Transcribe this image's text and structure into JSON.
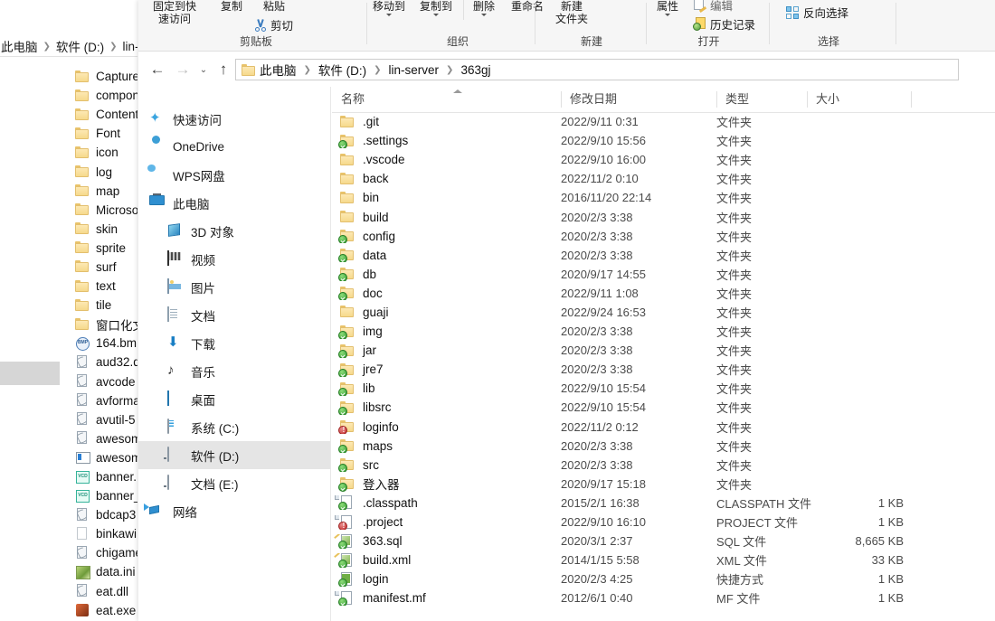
{
  "background_window": {
    "breadcrumb": [
      "此电脑",
      "软件 (D:)",
      "lin-"
    ],
    "files": [
      {
        "name": "Capture",
        "icon": "folder-icon"
      },
      {
        "name": "compon",
        "icon": "folder-icon"
      },
      {
        "name": "Content",
        "icon": "folder-icon"
      },
      {
        "name": "Font",
        "icon": "folder-icon"
      },
      {
        "name": "icon",
        "icon": "folder-icon"
      },
      {
        "name": "log",
        "icon": "folder-icon"
      },
      {
        "name": "map",
        "icon": "folder-icon"
      },
      {
        "name": "Microso",
        "icon": "folder-icon"
      },
      {
        "name": "skin",
        "icon": "folder-icon"
      },
      {
        "name": "sprite",
        "icon": "folder-icon"
      },
      {
        "name": "surf",
        "icon": "folder-icon"
      },
      {
        "name": "text",
        "icon": "folder-icon"
      },
      {
        "name": "tile",
        "icon": "folder-icon"
      },
      {
        "name": "窗口化文",
        "icon": "folder-icon"
      },
      {
        "name": "164.bm",
        "icon": "bmp-file-icon"
      },
      {
        "name": "aud32.d",
        "icon": "dll-file-icon"
      },
      {
        "name": "avcode",
        "icon": "dll-file-icon"
      },
      {
        "name": "avforma",
        "icon": "dll-file-icon"
      },
      {
        "name": "avutil-5",
        "icon": "dll-file-icon"
      },
      {
        "name": "awesom",
        "icon": "dll-file-icon"
      },
      {
        "name": "awesom",
        "icon": "app-file-icon"
      },
      {
        "name": "banner.",
        "icon": "vcd-file-icon"
      },
      {
        "name": "banner_",
        "icon": "vcd-file-icon"
      },
      {
        "name": "bdcap3",
        "icon": "dll-file-icon"
      },
      {
        "name": "binkawi",
        "icon": "blank-file-icon"
      },
      {
        "name": "chigame",
        "icon": "dll-file-icon"
      },
      {
        "name": "data.ini",
        "icon": "ini-file-icon"
      },
      {
        "name": "eat.dll",
        "icon": "dll-file-icon"
      },
      {
        "name": "eat.exe",
        "icon": "exe-file-icon"
      }
    ]
  },
  "ribbon": {
    "groups": [
      {
        "name": "剪贴板",
        "buttons": [
          {
            "label_line1": "固定到快",
            "label_line2": "速访问"
          },
          {
            "label_line1": "复制",
            "label_line2": ""
          },
          {
            "label_line1": "粘贴",
            "label_line2": ""
          },
          {
            "label_line1": "剪切",
            "icon": "scissors-icon"
          }
        ]
      },
      {
        "name": "组织",
        "buttons": [
          {
            "label_line1": "移动到",
            "has_dropdown": true
          },
          {
            "label_line1": "复制到",
            "has_dropdown": true
          },
          {
            "label_line1": "删除",
            "has_dropdown": true
          },
          {
            "label_line1": "重命名",
            "has_dropdown": false
          }
        ]
      },
      {
        "name": "新建",
        "buttons": [
          {
            "label_line1": "新建",
            "label_line2": "文件夹"
          }
        ]
      },
      {
        "name": "打开",
        "buttons": [
          {
            "label_line1": "属性",
            "has_dropdown": true,
            "icon": "properties-icon"
          },
          {
            "label_line1": "编辑",
            "icon": "edit-icon"
          },
          {
            "label_line1": "历史记录",
            "icon": "history-icon"
          }
        ]
      },
      {
        "name": "选择",
        "buttons": [
          {
            "label_line1": "反向选择",
            "icon": "invert-selection-icon"
          }
        ]
      }
    ]
  },
  "navigation": {
    "back_icon": "back-arrow-icon",
    "forward_icon": "forward-arrow-icon",
    "recent_icon": "chevron-down-icon",
    "up_icon": "up-arrow-icon",
    "breadcrumb": [
      "此电脑",
      "软件 (D:)",
      "lin-server",
      "363gj"
    ]
  },
  "nav_pane": {
    "items": [
      {
        "label": "快速访问",
        "icon": "pin-icon",
        "level": 0,
        "selected": false
      },
      {
        "label": "OneDrive",
        "icon": "cloud-icon",
        "level": 0,
        "selected": false
      },
      {
        "label": "WPS网盘",
        "icon": "wps-cloud-icon",
        "level": 0,
        "selected": false
      },
      {
        "label": "此电脑",
        "icon": "this-pc-icon",
        "level": 0,
        "selected": false
      },
      {
        "label": "3D 对象",
        "icon": "3d-objects-icon",
        "level": 1,
        "selected": false
      },
      {
        "label": "视频",
        "icon": "videos-icon",
        "level": 1,
        "selected": false
      },
      {
        "label": "图片",
        "icon": "pictures-icon",
        "level": 1,
        "selected": false
      },
      {
        "label": "文档",
        "icon": "documents-icon",
        "level": 1,
        "selected": false
      },
      {
        "label": "下载",
        "icon": "downloads-icon",
        "level": 1,
        "selected": false
      },
      {
        "label": "音乐",
        "icon": "music-icon",
        "level": 1,
        "selected": false
      },
      {
        "label": "桌面",
        "icon": "desktop-icon",
        "level": 1,
        "selected": false
      },
      {
        "label": "系统 (C:)",
        "icon": "system-drive-icon",
        "level": 1,
        "selected": false
      },
      {
        "label": "软件 (D:)",
        "icon": "drive-icon",
        "level": 1,
        "selected": true
      },
      {
        "label": "文档 (E:)",
        "icon": "drive-icon",
        "level": 1,
        "selected": false
      },
      {
        "label": "网络",
        "icon": "network-icon",
        "level": 0,
        "selected": false
      }
    ]
  },
  "file_list": {
    "columns": [
      {
        "label": "名称",
        "sorted": true
      },
      {
        "label": "修改日期",
        "sorted": false
      },
      {
        "label": "类型",
        "sorted": false
      },
      {
        "label": "大小",
        "sorted": false
      }
    ],
    "rows": [
      {
        "name": ".git",
        "date": "2022/9/11 0:31",
        "type": "文件夹",
        "size": "",
        "icon": "folder-icon",
        "badge": "none"
      },
      {
        "name": ".settings",
        "date": "2022/9/10 15:56",
        "type": "文件夹",
        "size": "",
        "icon": "folder-icon",
        "badge": "synced"
      },
      {
        "name": ".vscode",
        "date": "2022/9/10 16:00",
        "type": "文件夹",
        "size": "",
        "icon": "folder-icon",
        "badge": "none"
      },
      {
        "name": "back",
        "date": "2022/11/2 0:10",
        "type": "文件夹",
        "size": "",
        "icon": "folder-icon",
        "badge": "none"
      },
      {
        "name": "bin",
        "date": "2016/11/20 22:14",
        "type": "文件夹",
        "size": "",
        "icon": "folder-icon",
        "badge": "none"
      },
      {
        "name": "build",
        "date": "2020/2/3 3:38",
        "type": "文件夹",
        "size": "",
        "icon": "folder-icon",
        "badge": "none"
      },
      {
        "name": "config",
        "date": "2020/2/3 3:38",
        "type": "文件夹",
        "size": "",
        "icon": "folder-icon",
        "badge": "synced"
      },
      {
        "name": "data",
        "date": "2020/2/3 3:38",
        "type": "文件夹",
        "size": "",
        "icon": "folder-icon",
        "badge": "synced"
      },
      {
        "name": "db",
        "date": "2020/9/17 14:55",
        "type": "文件夹",
        "size": "",
        "icon": "folder-icon",
        "badge": "synced"
      },
      {
        "name": "doc",
        "date": "2022/9/11 1:08",
        "type": "文件夹",
        "size": "",
        "icon": "folder-icon",
        "badge": "synced"
      },
      {
        "name": "guaji",
        "date": "2022/9/24 16:53",
        "type": "文件夹",
        "size": "",
        "icon": "folder-icon",
        "badge": "none"
      },
      {
        "name": "img",
        "date": "2020/2/3 3:38",
        "type": "文件夹",
        "size": "",
        "icon": "folder-icon",
        "badge": "synced"
      },
      {
        "name": "jar",
        "date": "2020/2/3 3:38",
        "type": "文件夹",
        "size": "",
        "icon": "folder-icon",
        "badge": "synced"
      },
      {
        "name": "jre7",
        "date": "2020/2/3 3:38",
        "type": "文件夹",
        "size": "",
        "icon": "folder-icon",
        "badge": "synced"
      },
      {
        "name": "lib",
        "date": "2022/9/10 15:54",
        "type": "文件夹",
        "size": "",
        "icon": "folder-icon",
        "badge": "synced"
      },
      {
        "name": "libsrc",
        "date": "2022/9/10 15:54",
        "type": "文件夹",
        "size": "",
        "icon": "folder-icon",
        "badge": "synced"
      },
      {
        "name": "loginfo",
        "date": "2022/11/2 0:12",
        "type": "文件夹",
        "size": "",
        "icon": "folder-icon",
        "badge": "error"
      },
      {
        "name": "maps",
        "date": "2020/2/3 3:38",
        "type": "文件夹",
        "size": "",
        "icon": "folder-icon",
        "badge": "synced"
      },
      {
        "name": "src",
        "date": "2020/2/3 3:38",
        "type": "文件夹",
        "size": "",
        "icon": "folder-icon",
        "badge": "synced"
      },
      {
        "name": "登入器",
        "date": "2020/9/17 15:18",
        "type": "文件夹",
        "size": "",
        "icon": "folder-icon",
        "badge": "synced"
      },
      {
        "name": ".classpath",
        "date": "2015/2/1 16:38",
        "type": "CLASSPATH 文件",
        "size": "1 KB",
        "icon": "file-icon",
        "badge": "synced"
      },
      {
        "name": ".project",
        "date": "2022/9/10 16:10",
        "type": "PROJECT 文件",
        "size": "1 KB",
        "icon": "file-icon",
        "badge": "error"
      },
      {
        "name": "363.sql",
        "date": "2020/3/1 2:37",
        "type": "SQL 文件",
        "size": "8,665 KB",
        "icon": "xml-file-icon",
        "badge": "synced"
      },
      {
        "name": "build.xml",
        "date": "2014/1/15 5:58",
        "type": "XML 文件",
        "size": "33 KB",
        "icon": "xml-file-icon",
        "badge": "synced"
      },
      {
        "name": "login",
        "date": "2020/2/3 4:25",
        "type": "快捷方式",
        "size": "1 KB",
        "icon": "shortcut-icon",
        "badge": "synced"
      },
      {
        "name": "manifest.mf",
        "date": "2012/6/1 0:40",
        "type": "MF 文件",
        "size": "1 KB",
        "icon": "file-icon",
        "badge": "synced"
      }
    ]
  }
}
